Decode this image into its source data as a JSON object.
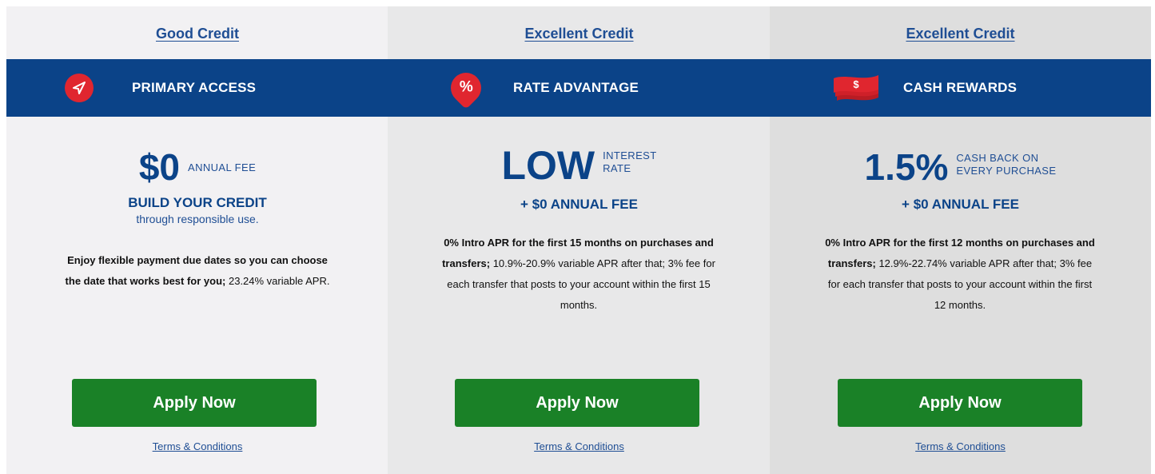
{
  "cards": [
    {
      "tier": "Good Credit",
      "band_label": "PRIMARY ACCESS",
      "icon": "paper-plane-icon",
      "headline_big": "$0",
      "headline_small": [
        "ANNUAL FEE"
      ],
      "sub_bold": "BUILD YOUR CREDIT",
      "sub_light": "through responsible use.",
      "desc_bold": "Enjoy flexible payment due dates so you can choose the date that works best for you;",
      "desc_regular": "23.24% variable APR.",
      "apply_label": "Apply Now",
      "terms_label": "Terms & Conditions"
    },
    {
      "tier": "Excellent Credit",
      "band_label": "RATE ADVANTAGE",
      "icon": "percent-icon",
      "icon_glyph": "%",
      "headline_big": "LOW",
      "headline_small": [
        "INTEREST",
        "RATE"
      ],
      "sub_bold": "+ $0 ANNUAL FEE",
      "desc_bold": "0% Intro APR for the first 15 months on purchases and transfers;",
      "desc_regular": "10.9%-20.9% variable APR after that; 3% fee for each transfer that posts to your account within the first 15 months.",
      "apply_label": "Apply Now",
      "terms_label": "Terms & Conditions"
    },
    {
      "tier": "Excellent Credit",
      "band_label": "CASH REWARDS",
      "icon": "cash-icon",
      "icon_glyph": "$",
      "headline_big": "1.5%",
      "headline_small": [
        "CASH BACK ON",
        "EVERY PURCHASE"
      ],
      "sub_bold": "+ $0 ANNUAL FEE",
      "desc_bold": "0% Intro APR for the first 12 months on purchases and transfers;",
      "desc_regular": "12.9%-22.74% variable APR after that; 3% fee for each transfer that posts to your account within the first 12 months.",
      "apply_label": "Apply Now",
      "terms_label": "Terms & Conditions"
    }
  ],
  "colors": {
    "band": "#0b4388",
    "accent_red": "#e0262f",
    "apply_green": "#1a8127",
    "link_blue": "#1f4e94"
  }
}
